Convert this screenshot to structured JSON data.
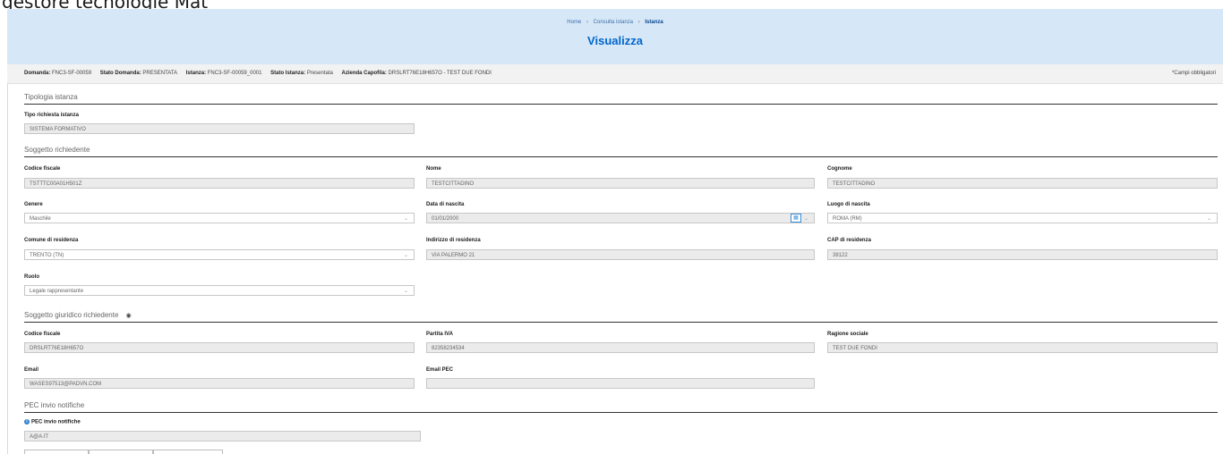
{
  "top_caption": "gestore tecnologie Mat",
  "breadcrumb": {
    "home": "Home",
    "sep": "›",
    "consulta": "Consulta istanza",
    "current": "Istanza"
  },
  "page": {
    "title": "Visualizza"
  },
  "infobar": {
    "domanda_label": "Domanda:",
    "domanda_value": "FNC3-SF-00059",
    "stato_domanda_label": "Stato Domanda:",
    "stato_domanda_value": "PRESENTATA",
    "istanza_label": "Istanza:",
    "istanza_value": "FNC3-SF-00059_0001",
    "stato_istanza_label": "Stato Istanza:",
    "stato_istanza_value": "Presentata",
    "azienda_label": "Azienda Capofila:",
    "azienda_value": "DRSLRT76E18H657O - TEST DUE FONDI",
    "required_note": "*Campi obbligatori"
  },
  "sections": {
    "tipologia": "Tipologia istanza",
    "soggetto": "Soggetto richiedente",
    "giuridico": "Soggetto giuridico richiedente",
    "pec": "PEC invio notifiche"
  },
  "fields": {
    "tipo_richiesta": {
      "label": "Tipo richiesta istanza",
      "value": "SISTEMA FORMATIVO"
    },
    "codice_fiscale": {
      "label": "Codice fiscale",
      "value": "TSTTTC00A01H501Z"
    },
    "nome": {
      "label": "Nome",
      "value": "TESTCITTADINO"
    },
    "cognome": {
      "label": "Cognome",
      "value": "TESTCITTADINO"
    },
    "genere": {
      "label": "Genere",
      "value": "Maschile"
    },
    "data_nascita": {
      "label": "Data di nascita",
      "value": "01/01/2000"
    },
    "luogo_nascita": {
      "label": "Luogo di nascita",
      "value": "ROMA (RM)"
    },
    "comune_residenza": {
      "label": "Comune di residenza",
      "value": "TRENTO (TN)"
    },
    "indirizzo_residenza": {
      "label": "Indirizzo di residenza",
      "value": "VIA PALERMO 21"
    },
    "cap_residenza": {
      "label": "CAP di residenza",
      "value": "38122"
    },
    "ruolo": {
      "label": "Ruolo",
      "value": "Legale rappresentante"
    },
    "sg_codice_fiscale": {
      "label": "Codice fiscale",
      "value": "DRSLRT76E18H657O"
    },
    "partita_iva": {
      "label": "Partita IVA",
      "value": "82358234534"
    },
    "ragione_sociale": {
      "label": "Ragione sociale",
      "value": "TEST DUE FONDI"
    },
    "email": {
      "label": "Email",
      "value": "WASES97513@PADVN.COM"
    },
    "email_pec": {
      "label": "Email PEC",
      "value": ""
    },
    "pec_notifiche": {
      "label": "PEC invio notifiche",
      "value": "A@A.IT"
    }
  },
  "icons": {
    "chevron": "chevron-down-icon",
    "calendar": "calendar-icon",
    "eye": "eye-icon",
    "info": "info-icon"
  },
  "colors": {
    "header_bg": "#d6e7f7",
    "title": "#0066cc",
    "field_bg": "#ebebeb"
  }
}
